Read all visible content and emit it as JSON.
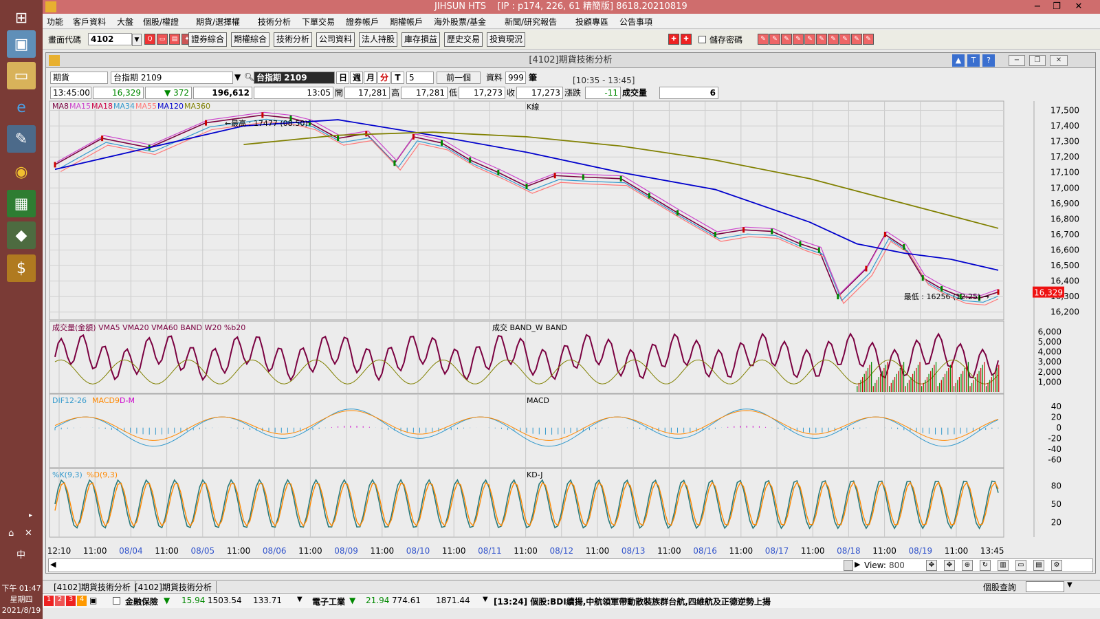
{
  "window": {
    "title": "JIHSUN HTS",
    "info": "[IP : p174, 226, 61 精簡版] 8618.20210819"
  },
  "menu": [
    "功能",
    "客戶資料",
    "大盤",
    "個股/權證",
    "期貨/選擇權",
    "技術分析",
    "下單交易",
    "證券帳戶",
    "期權帳戶",
    "海外股票/基金",
    "新聞/研究報告",
    "投顧專區",
    "公告事項"
  ],
  "toolbar": {
    "code_label": "畫面代碼",
    "code_value": "4102",
    "buttons": [
      "證券綜合",
      "期權綜合",
      "技術分析",
      "公司資料",
      "法人持股",
      "庫存損益",
      "歷史交易",
      "投資現況"
    ],
    "save_password": "儲存密碼"
  },
  "taskbar": {
    "clock_time": "下午 01:47",
    "clock_day": "星期四",
    "clock_date": "2021/8/19",
    "ime": "中"
  },
  "panel": {
    "title": "[4102]期貨技術分析",
    "market": "期貨",
    "contract_select": "台指期 2109",
    "contract_name": "台指期 2109",
    "periods": [
      "日",
      "週",
      "月",
      "分",
      "T"
    ],
    "minutes": "5",
    "prev_label": "前一個",
    "data_label": "資料",
    "data_count": "999",
    "data_unit": "筆",
    "time_range": "[10:35 - 13:45]"
  },
  "quote": {
    "time": "13:45:00",
    "price": "16,329",
    "change": "372",
    "volume": "196,612",
    "bar_time": "13:05",
    "open_label": "開",
    "open": "17,281",
    "high_label": "高",
    "high": "17,281",
    "low_label": "低",
    "low": "17,273",
    "close_label": "收",
    "close": "17,273",
    "chg_label": "漲跌",
    "chg": "-11",
    "vol_label": "成交量",
    "vol": "6"
  },
  "chart_data": [
    {
      "type": "line",
      "title": "K線",
      "legend": [
        {
          "name": "MA8",
          "color": "#7a0040"
        },
        {
          "name": "MA15",
          "color": "#cc44cc"
        },
        {
          "name": "MA18",
          "color": "#cc0044"
        },
        {
          "name": "MA34",
          "color": "#3399cc"
        },
        {
          "name": "MA55",
          "color": "#ff7777"
        },
        {
          "name": "MA120",
          "color": "#0000cc"
        },
        {
          "name": "MA360",
          "color": "#808000"
        }
      ],
      "y_ticks": [
        17500,
        17400,
        17300,
        17200,
        17100,
        17000,
        16900,
        16800,
        16700,
        16600,
        16500,
        16400,
        16300,
        16200
      ],
      "ylim": [
        16150,
        17560
      ],
      "x_ticks": [
        "12:10",
        "11:00",
        "08/04",
        "11:00",
        "08/05",
        "11:00",
        "08/06",
        "11:00",
        "08/09",
        "11:00",
        "08/10",
        "11:00",
        "08/11",
        "11:00",
        "08/12",
        "11:00",
        "08/13",
        "11:00",
        "08/16",
        "11:00",
        "08/17",
        "11:00",
        "08/18",
        "11:00",
        "08/19",
        "11:00",
        "13:45"
      ],
      "annotations": {
        "high": "最高 : 17477 (08:50)",
        "low": "最低 : 16256 (12:25)"
      },
      "last_price": "16,329",
      "series": [
        {
          "name": "Price",
          "x": [
            0,
            0.05,
            0.1,
            0.16,
            0.22,
            0.25,
            0.27,
            0.3,
            0.33,
            0.36,
            0.38,
            0.41,
            0.44,
            0.47,
            0.5,
            0.53,
            0.56,
            0.6,
            0.63,
            0.66,
            0.7,
            0.73,
            0.76,
            0.79,
            0.81,
            0.83,
            0.86,
            0.88,
            0.9,
            0.92,
            0.94,
            0.96,
            0.98,
            1.0
          ],
          "values": [
            17150,
            17320,
            17260,
            17420,
            17470,
            17450,
            17420,
            17320,
            17350,
            17160,
            17330,
            17290,
            17180,
            17100,
            17010,
            17080,
            17070,
            17060,
            16950,
            16840,
            16700,
            16730,
            16720,
            16640,
            16600,
            16300,
            16480,
            16700,
            16620,
            16420,
            16350,
            16300,
            16290,
            16329
          ]
        },
        {
          "name": "MA120",
          "x": [
            0,
            0.1,
            0.2,
            0.3,
            0.4,
            0.5,
            0.6,
            0.7,
            0.8,
            0.85,
            0.9,
            0.95,
            1.0
          ],
          "values": [
            17120,
            17260,
            17400,
            17440,
            17340,
            17230,
            17100,
            16990,
            16780,
            16640,
            16580,
            16540,
            16470
          ]
        },
        {
          "name": "MA360",
          "x": [
            0.2,
            0.3,
            0.4,
            0.5,
            0.6,
            0.7,
            0.8,
            0.9,
            1.0
          ],
          "values": [
            17280,
            17340,
            17360,
            17330,
            17270,
            17180,
            17060,
            16900,
            16740
          ]
        }
      ]
    },
    {
      "type": "bar",
      "title": "成交 BAND_W BAND",
      "legend": [
        "成交量(金額)",
        "VMA5",
        "VMA20",
        "VMA60",
        "BAND",
        "W20",
        "%b20"
      ],
      "y_ticks": [
        6000,
        5000,
        4000,
        3000,
        2000,
        1000
      ]
    },
    {
      "type": "line",
      "title": "MACD",
      "legend": [
        "DIF12-26",
        "MACD9",
        "D-M"
      ],
      "y_ticks": [
        40,
        20,
        0,
        -20,
        -40,
        -60
      ]
    },
    {
      "type": "line",
      "title": "KD-J",
      "legend": [
        "%K(9,3)",
        "%D(9,3)"
      ],
      "y_ticks": [
        80,
        50,
        20
      ]
    }
  ],
  "scrollbar": {
    "view_label": "View:",
    "view_value": "800"
  },
  "tabs": [
    "[4102]期貨技術分析",
    "[4102]期貨技術分析"
  ],
  "ticker": {
    "sector1": "金融保險",
    "s1_change": "15.94",
    "s1_index": "1503.54",
    "s1_vol": "133.71",
    "sector2": "電子工業",
    "s2_change": "21.94",
    "s2_index": "774.61",
    "s2_vol": "1871.44",
    "news": "[13:24] 個股:BDI續揚,中航領軍帶動散裝族群台航,四維航及正德逆勢上揚",
    "query": "個股查詢"
  },
  "colors": {
    "title_bar": "#cf6d6d",
    "up": "#cc0000",
    "down": "#008800",
    "bg": "#ececec"
  }
}
